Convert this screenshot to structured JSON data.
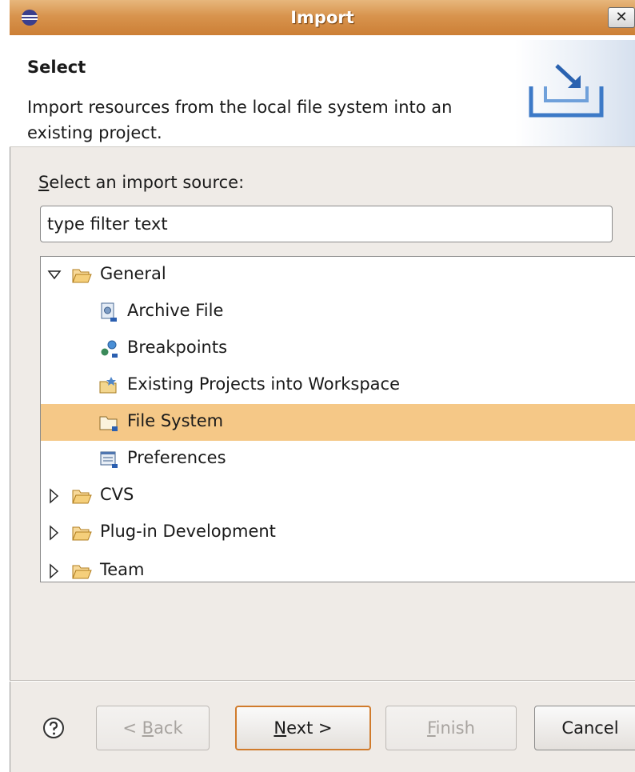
{
  "window": {
    "title": "Import",
    "close": "✕"
  },
  "header": {
    "title": "Select",
    "description": "Import resources from the local file system into an existing project."
  },
  "source": {
    "label_mnemonic": "S",
    "label_rest": "elect an import source:",
    "filter_value": "type filter text"
  },
  "tree": {
    "items": [
      {
        "label": "General",
        "expanded": true,
        "icon": "folder-open-icon"
      },
      {
        "label": "Archive File",
        "icon": "archive-file-icon"
      },
      {
        "label": "Breakpoints",
        "icon": "breakpoints-icon"
      },
      {
        "label": "Existing Projects into Workspace",
        "icon": "project-icon"
      },
      {
        "label": "File System",
        "icon": "folder-icon",
        "selected": true
      },
      {
        "label": "Preferences",
        "icon": "preferences-icon"
      },
      {
        "label": "CVS",
        "expanded": false,
        "icon": "folder-open-icon"
      },
      {
        "label": "Plug-in Development",
        "expanded": false,
        "icon": "folder-open-icon"
      },
      {
        "label": "Team",
        "expanded": false,
        "icon": "folder-open-icon"
      }
    ]
  },
  "buttons": {
    "back_prefix": "< ",
    "back_mnemonic": "B",
    "back_rest": "ack",
    "next_mnemonic": "N",
    "next_rest": "ext >",
    "finish_mnemonic": "F",
    "finish_rest": "inish",
    "cancel": "Cancel"
  },
  "colors": {
    "titlebar": "#d8944e",
    "selection": "#f5c887",
    "default_button_border": "#d07b2c"
  }
}
